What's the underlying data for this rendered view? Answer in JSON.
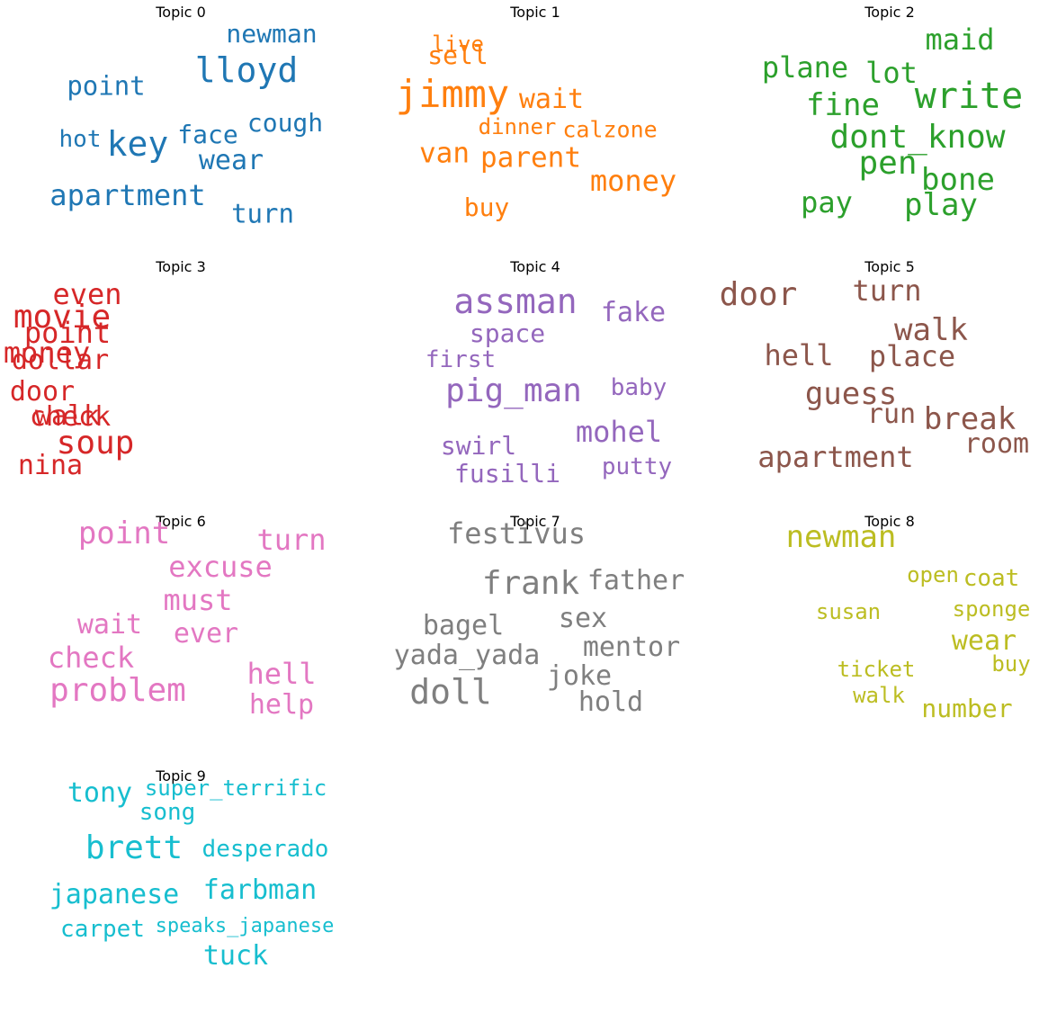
{
  "chart_data": [
    {
      "type": "wordcloud",
      "title": "Topic 0",
      "color": "#1f77b4",
      "words": [
        {
          "text": "newman",
          "weight": 0.6
        },
        {
          "text": "lloyd",
          "weight": 0.85
        },
        {
          "text": "point",
          "weight": 0.62
        },
        {
          "text": "cough",
          "weight": 0.58
        },
        {
          "text": "face",
          "weight": 0.58
        },
        {
          "text": "key",
          "weight": 1.0
        },
        {
          "text": "hot",
          "weight": 0.52
        },
        {
          "text": "wear",
          "weight": 0.6
        },
        {
          "text": "apartment",
          "weight": 0.68
        },
        {
          "text": "turn",
          "weight": 0.6
        }
      ]
    },
    {
      "type": "wordcloud",
      "title": "Topic 1",
      "color": "#ff7f0e",
      "words": [
        {
          "text": "live",
          "weight": 0.5
        },
        {
          "text": "sell",
          "weight": 0.58
        },
        {
          "text": "jimmy",
          "weight": 1.0
        },
        {
          "text": "wait",
          "weight": 0.62
        },
        {
          "text": "dinner",
          "weight": 0.52
        },
        {
          "text": "calzone",
          "weight": 0.55
        },
        {
          "text": "van",
          "weight": 0.66
        },
        {
          "text": "parent",
          "weight": 0.66
        },
        {
          "text": "money",
          "weight": 0.72
        },
        {
          "text": "buy",
          "weight": 0.6
        }
      ]
    },
    {
      "type": "wordcloud",
      "title": "Topic 2",
      "color": "#2ca02c",
      "words": [
        {
          "text": "maid",
          "weight": 0.75
        },
        {
          "text": "plane",
          "weight": 0.75
        },
        {
          "text": "lot",
          "weight": 0.8
        },
        {
          "text": "write",
          "weight": 0.95
        },
        {
          "text": "fine",
          "weight": 0.8
        },
        {
          "text": "dont_know",
          "weight": 0.92
        },
        {
          "text": "pen",
          "weight": 0.85
        },
        {
          "text": "bone",
          "weight": 0.8
        },
        {
          "text": "pay",
          "weight": 0.76
        },
        {
          "text": "play",
          "weight": 0.78
        }
      ]
    },
    {
      "type": "wordcloud",
      "title": "Topic 3",
      "color": "#d62728",
      "words": [
        {
          "text": "even",
          "weight": 0.75
        },
        {
          "text": "movie",
          "weight": 0.9
        },
        {
          "text": "point",
          "weight": 0.8
        },
        {
          "text": "money",
          "weight": 0.8
        },
        {
          "text": "dollar",
          "weight": 0.76
        },
        {
          "text": "door",
          "weight": 0.76
        },
        {
          "text": "check",
          "weight": 0.75
        },
        {
          "text": "walk",
          "weight": 0.78
        },
        {
          "text": "soup",
          "weight": 0.95
        },
        {
          "text": "nina",
          "weight": 0.78
        }
      ]
    },
    {
      "type": "wordcloud",
      "title": "Topic 4",
      "color": "#9467bd",
      "words": [
        {
          "text": "assman",
          "weight": 1.0
        },
        {
          "text": "fake",
          "weight": 0.8
        },
        {
          "text": "space",
          "weight": 0.72
        },
        {
          "text": "first",
          "weight": 0.68
        },
        {
          "text": "pig_man",
          "weight": 0.95
        },
        {
          "text": "baby",
          "weight": 0.68
        },
        {
          "text": "mohel",
          "weight": 0.88
        },
        {
          "text": "swirl",
          "weight": 0.76
        },
        {
          "text": "putty",
          "weight": 0.7
        },
        {
          "text": "fusilli",
          "weight": 0.76
        }
      ]
    },
    {
      "type": "wordcloud",
      "title": "Topic 5",
      "color": "#8c564b",
      "words": [
        {
          "text": "door",
          "weight": 1.0
        },
        {
          "text": "turn",
          "weight": 0.88
        },
        {
          "text": "walk",
          "weight": 0.92
        },
        {
          "text": "hell",
          "weight": 0.85
        },
        {
          "text": "place",
          "weight": 0.88
        },
        {
          "text": "guess",
          "weight": 0.9
        },
        {
          "text": "run",
          "weight": 0.8
        },
        {
          "text": "break",
          "weight": 0.88
        },
        {
          "text": "room",
          "weight": 0.8
        },
        {
          "text": "apartment",
          "weight": 0.88
        }
      ]
    },
    {
      "type": "wordcloud",
      "title": "Topic 6",
      "color": "#e377c2",
      "words": [
        {
          "text": "point",
          "weight": 0.95
        },
        {
          "text": "turn",
          "weight": 0.85
        },
        {
          "text": "excuse",
          "weight": 0.88
        },
        {
          "text": "must",
          "weight": 0.88
        },
        {
          "text": "wait",
          "weight": 0.82
        },
        {
          "text": "ever",
          "weight": 0.85
        },
        {
          "text": "check",
          "weight": 0.9
        },
        {
          "text": "hell",
          "weight": 0.9
        },
        {
          "text": "problem",
          "weight": 1.0
        },
        {
          "text": "help",
          "weight": 0.85
        }
      ]
    },
    {
      "type": "wordcloud",
      "title": "Topic 7",
      "color": "#7f7f7f",
      "words": [
        {
          "text": "festivus",
          "weight": 0.88
        },
        {
          "text": "frank",
          "weight": 1.0
        },
        {
          "text": "father",
          "weight": 0.85
        },
        {
          "text": "sex",
          "weight": 0.85
        },
        {
          "text": "bagel",
          "weight": 0.82
        },
        {
          "text": "mentor",
          "weight": 0.85
        },
        {
          "text": "yada_yada",
          "weight": 0.82
        },
        {
          "text": "joke",
          "weight": 0.85
        },
        {
          "text": "doll",
          "weight": 1.0
        },
        {
          "text": "hold",
          "weight": 0.85
        }
      ]
    },
    {
      "type": "wordcloud",
      "title": "Topic 8",
      "color": "#bcbd22",
      "words": [
        {
          "text": "newman",
          "weight": 1.0
        },
        {
          "text": "open",
          "weight": 0.62
        },
        {
          "text": "coat",
          "weight": 0.7
        },
        {
          "text": "susan",
          "weight": 0.62
        },
        {
          "text": "sponge",
          "weight": 0.62
        },
        {
          "text": "wear",
          "weight": 0.8
        },
        {
          "text": "buy",
          "weight": 0.62
        },
        {
          "text": "ticket",
          "weight": 0.68
        },
        {
          "text": "walk",
          "weight": 0.66
        },
        {
          "text": "number",
          "weight": 0.78
        }
      ]
    },
    {
      "type": "wordcloud",
      "title": "Topic 9",
      "color": "#17becf",
      "words": [
        {
          "text": "tony",
          "weight": 0.9
        },
        {
          "text": "super_terrific",
          "weight": 0.7
        },
        {
          "text": "song",
          "weight": 0.75
        },
        {
          "text": "brett",
          "weight": 1.0
        },
        {
          "text": "desperado",
          "weight": 0.72
        },
        {
          "text": "japanese",
          "weight": 0.85
        },
        {
          "text": "farbman",
          "weight": 0.9
        },
        {
          "text": "carpet",
          "weight": 0.78
        },
        {
          "text": "speaks_japanese",
          "weight": 0.6
        },
        {
          "text": "tuck",
          "weight": 0.85
        }
      ]
    }
  ]
}
